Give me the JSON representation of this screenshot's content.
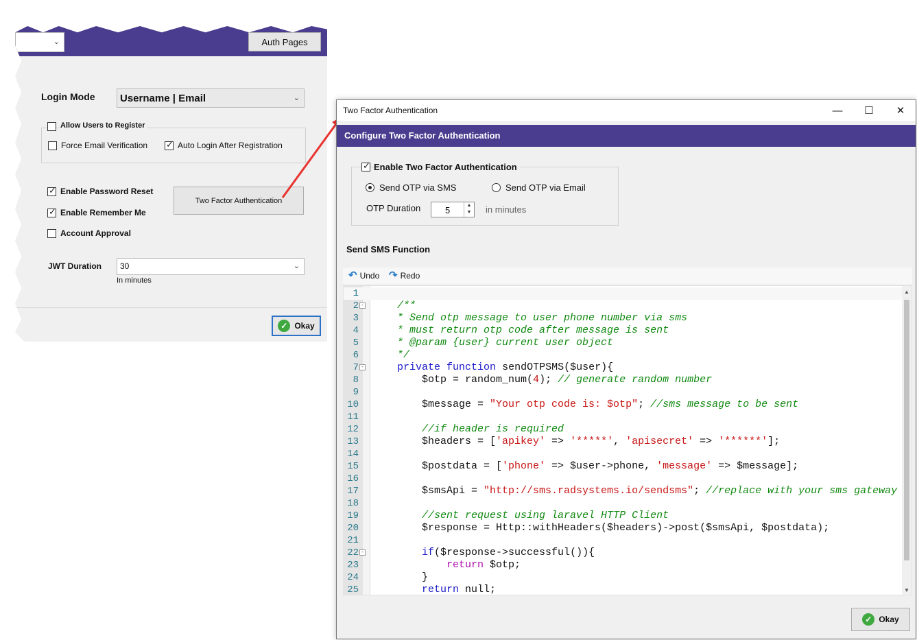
{
  "left_window": {
    "auth_pages_button": "Auth Pages",
    "login_mode_label": "Login Mode",
    "login_mode_value": "Username | Email",
    "allow_register_label": "Allow Users to Register",
    "allow_register_checked": false,
    "force_email_label": "Force Email Verification",
    "force_email_checked": false,
    "auto_login_label": "Auto Login After Registration",
    "auto_login_checked": true,
    "password_reset_label": "Enable Password Reset",
    "password_reset_checked": true,
    "remember_me_label": "Enable Remember Me",
    "remember_me_checked": true,
    "account_approval_label": "Account Approval",
    "account_approval_checked": false,
    "two_factor_button": "Two Factor Authentication",
    "jwt_label": "JWT Duration",
    "jwt_value": "30",
    "jwt_hint": "In minutes",
    "okay_button": "Okay"
  },
  "dialog": {
    "window_title": "Two Factor Authentication",
    "header": "Configure Two Factor Authentication",
    "enable_label": "Enable Two Factor Authentication",
    "enable_checked": true,
    "sms_radio_label": "Send OTP via SMS",
    "email_radio_label": "Send OTP via Email",
    "selected_method": "sms",
    "otp_duration_label": "OTP Duration",
    "otp_duration_value": "5",
    "otp_duration_hint": "in minutes",
    "sms_function_label": "Send SMS Function",
    "undo_label": "Undo",
    "redo_label": "Redo",
    "okay_button": "Okay"
  },
  "code": {
    "lines": [
      "",
      "    /**",
      "    * Send otp message to user phone number via sms",
      "    * must return otp code after message is sent",
      "    * @param {user} current user object",
      "    */",
      "    private function sendOTPSMS($user){",
      "        $otp = random_num(4); // generate random number",
      "",
      "        $message = \"Your otp code is: $otp\"; //sms message to be sent",
      "",
      "        //if header is required",
      "        $headers = ['apikey' => '*****', 'apisecret' => '******'];",
      "",
      "        $postdata = ['phone' => $user->phone, 'message' => $message];",
      "",
      "        $smsApi = \"http://sms.radsystems.io/sendsms\"; //replace with your sms gateway",
      "",
      "        //sent request using laravel HTTP Client",
      "        $response = Http::withHeaders($headers)->post($smsApi, $postdata);",
      "",
      "        if($response->successful()){",
      "            return $otp;",
      "        }",
      "        return null;"
    ]
  },
  "colors": {
    "header_purple": "#4a3d8f",
    "comment": "#118a11",
    "keyword": "#1818c8",
    "string": "#c81414",
    "line_number": "#2b7a8c"
  },
  "icons": [
    "chevron-down-icon",
    "checkbox-icon",
    "radio-icon",
    "undo-icon",
    "redo-icon",
    "checkmark-icon",
    "minimize-icon",
    "maximize-icon",
    "close-icon",
    "red-arrow"
  ]
}
